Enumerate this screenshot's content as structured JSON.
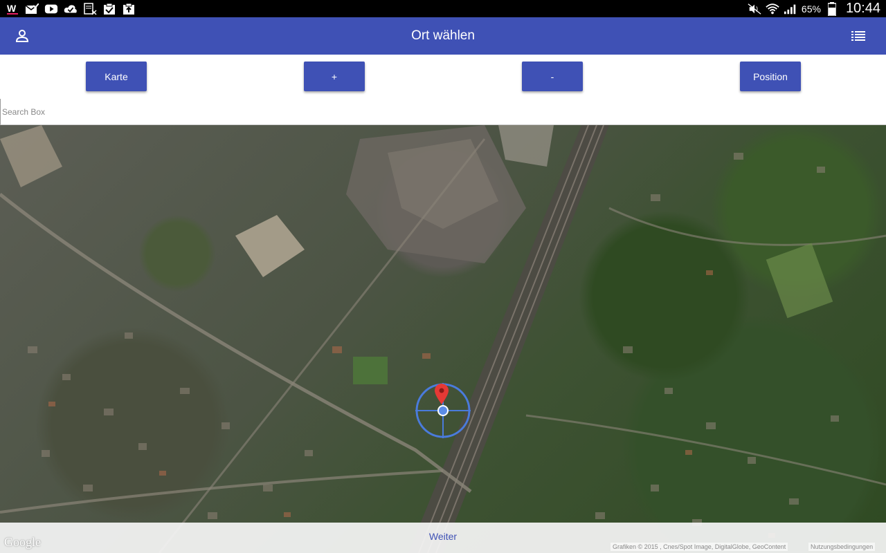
{
  "status_bar": {
    "battery": "65%",
    "time": "10:44",
    "notification_icons": [
      "w-app-icon",
      "mail-check-icon",
      "youtube-icon",
      "cloud-check-icon",
      "ledger-icon",
      "clipboard-check-icon",
      "clipboard-upload-icon"
    ],
    "system_icons": [
      "mute-icon",
      "wifi-icon",
      "signal-icon",
      "battery-icon"
    ]
  },
  "app_bar": {
    "title": "Ort wählen",
    "left_icon": "person-icon",
    "right_icon": "list-icon",
    "color": "#3f51b5"
  },
  "toolbar": {
    "karte_label": "Karte",
    "plus_label": "+",
    "minus_label": "-",
    "position_label": "Position"
  },
  "search": {
    "placeholder": "Search Box",
    "value": ""
  },
  "map": {
    "type": "satellite",
    "marker_color": "#e53935",
    "crosshair_color": "#4a7bdc"
  },
  "bottom_bar": {
    "weiter_label": "Weiter",
    "google_logo": "Google",
    "attribution": "Grafiken © 2015 , Cnes/Spot Image, DigitalGlobe, GeoContent",
    "terms": "Nutzungsbedingungen"
  }
}
